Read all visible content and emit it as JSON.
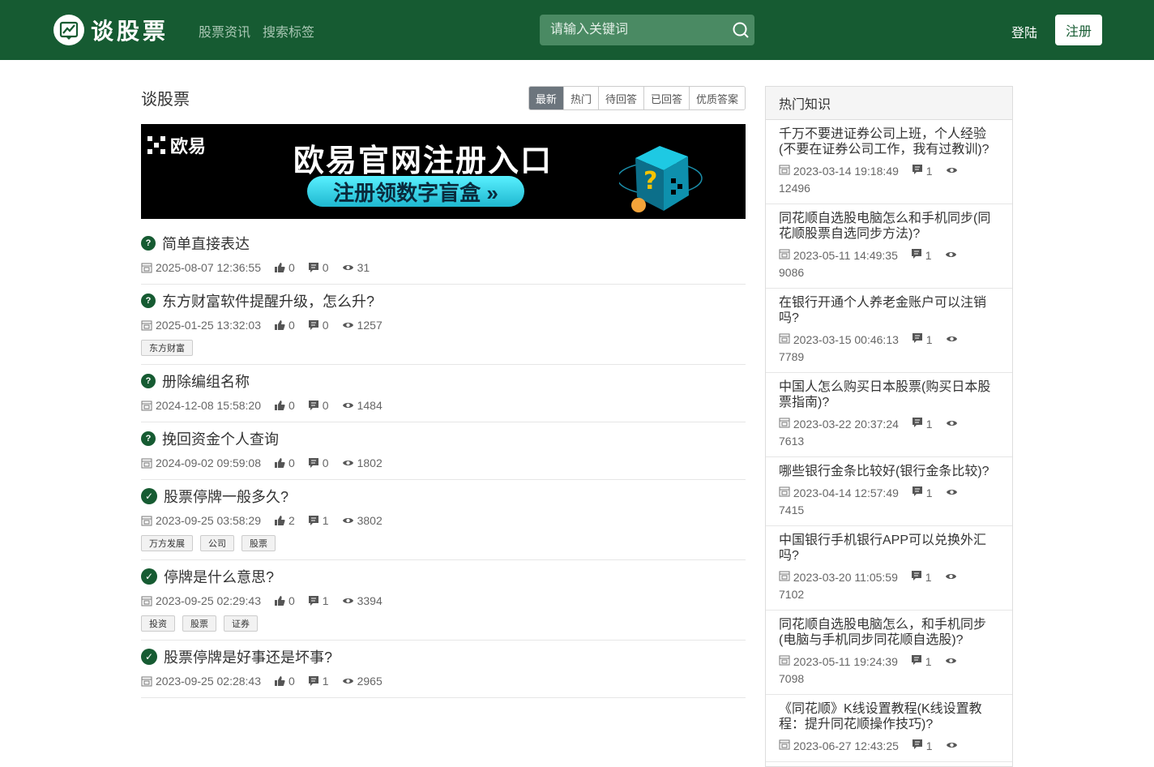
{
  "header": {
    "logo_text": "谈股票",
    "nav": [
      "股票资讯",
      "搜索标签"
    ],
    "search_placeholder": "请输入关键词",
    "login": "登陆",
    "register": "注册"
  },
  "main": {
    "title": "谈股票",
    "tabs": [
      "最新",
      "热门",
      "待回答",
      "已回答",
      "优质答案"
    ],
    "active_tab": "最新",
    "banner": {
      "brand": "欧易",
      "headline": "欧易官网注册入口",
      "button": "注册领数字盲盒 »"
    },
    "questions": [
      {
        "title": "简单直接表达",
        "answered": false,
        "date": "2025-08-07 12:36:55",
        "likes": "0",
        "answers": "0",
        "views": "31",
        "tags": []
      },
      {
        "title": "东方财富软件提醒升级，怎么升?",
        "answered": false,
        "date": "2025-01-25 13:32:03",
        "likes": "0",
        "answers": "0",
        "views": "1257",
        "tags": [
          "东方财富"
        ]
      },
      {
        "title": "册除编组名称",
        "answered": false,
        "date": "2024-12-08 15:58:20",
        "likes": "0",
        "answers": "0",
        "views": "1484",
        "tags": []
      },
      {
        "title": "挽回资金个人查询",
        "answered": false,
        "date": "2024-09-02 09:59:08",
        "likes": "0",
        "answers": "0",
        "views": "1802",
        "tags": []
      },
      {
        "title": "股票停牌一般多久?",
        "answered": true,
        "date": "2023-09-25 03:58:29",
        "likes": "2",
        "answers": "1",
        "views": "3802",
        "tags": [
          "万方发展",
          "公司",
          "股票"
        ]
      },
      {
        "title": "停牌是什么意思?",
        "answered": true,
        "date": "2023-09-25 02:29:43",
        "likes": "0",
        "answers": "1",
        "views": "3394",
        "tags": [
          "投资",
          "股票",
          "证券"
        ]
      },
      {
        "title": "股票停牌是好事还是坏事?",
        "answered": true,
        "date": "2023-09-25 02:28:43",
        "likes": "0",
        "answers": "1",
        "views": "2965",
        "tags": []
      }
    ]
  },
  "sidebar": {
    "title": "热门知识",
    "items": [
      {
        "title": "千万不要进证券公司上班，个人经验(不要在证券公司工作，我有过教训)?",
        "date": "2023-03-14 19:18:49",
        "answers": "1",
        "views": "12496"
      },
      {
        "title": "同花顺自选股电脑怎么和手机同步(同花顺股票自选同步方法)?",
        "date": "2023-05-11 14:49:35",
        "answers": "1",
        "views": "9086"
      },
      {
        "title": "在银行开通个人养老金账户可以注销吗?",
        "date": "2023-03-15 00:46:13",
        "answers": "1",
        "views": "7789"
      },
      {
        "title": "中国人怎么购买日本股票(购买日本股票指南)?",
        "date": "2023-03-22 20:37:24",
        "answers": "1",
        "views": "7613"
      },
      {
        "title": "哪些银行金条比较好(银行金条比较)?",
        "date": "2023-04-14 12:57:49",
        "answers": "1",
        "views": "7415"
      },
      {
        "title": "中国银行手机银行APP可以兑换外汇吗?",
        "date": "2023-03-20 11:05:59",
        "answers": "1",
        "views": "7102"
      },
      {
        "title": "同花顺自选股电脑怎么，和手机同步(电脑与手机同步同花顺自选股)?",
        "date": "2023-05-11 19:24:39",
        "answers": "1",
        "views": "7098"
      },
      {
        "title": "《同花顺》K线设置教程(K线设置教程：提升同花顺操作技巧)?",
        "date": "2023-06-27 12:43:25",
        "answers": "1",
        "views": ""
      }
    ]
  },
  "colors": {
    "brand": "#165b32",
    "search_bg": "#4a8a63",
    "tab_active": "#6c757d"
  }
}
